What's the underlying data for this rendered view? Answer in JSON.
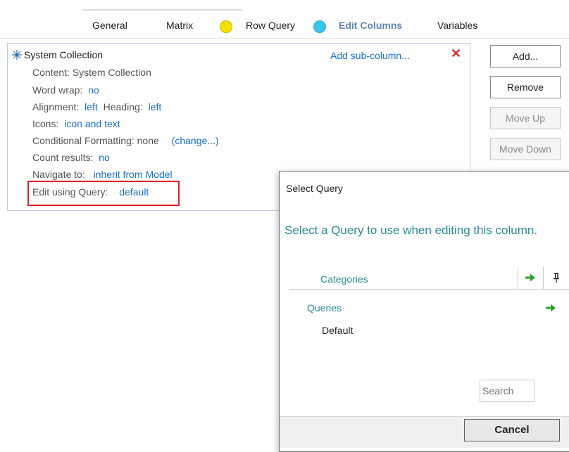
{
  "tabs": [
    {
      "label": "General"
    },
    {
      "label": "Matrix"
    },
    {
      "label": "Row Query"
    },
    {
      "label": "Edit Columns"
    },
    {
      "label": "Variables"
    }
  ],
  "column": {
    "title": "System Collection",
    "add_sub_column": "Add sub-column...",
    "delete_glyph": "✕",
    "content_label": "Content:",
    "content_value": "System Collection",
    "word_wrap_label": "Word wrap:",
    "word_wrap_value": "no",
    "alignment_label": "Alignment:",
    "alignment_value": "left",
    "heading_label": "Heading:",
    "heading_value": "left",
    "icons_label": "Icons:",
    "icons_value": "icon and text",
    "cond_format_label": "Conditional Formatting: none",
    "cond_format_change": "(change...)",
    "count_label": "Count results:",
    "count_value": "no",
    "navigate_label": "Navigate to:",
    "navigate_value": "inherit from Model",
    "edit_query_label": "Edit using Query:",
    "edit_query_value": "default"
  },
  "buttons": {
    "add": "Add...",
    "remove": "Remove",
    "move_up": "Move Up",
    "move_down": "Move Down"
  },
  "dialog": {
    "title": "Select Query",
    "description": "Select a Query to use when editing this column.",
    "categories_label": "Categories",
    "queries_label": "Queries",
    "items": [
      "Default"
    ],
    "search_placeholder": "Search",
    "cancel": "Cancel"
  },
  "colors": {
    "accent_teal": "#2b8a9b",
    "link_blue": "#1a6fd1",
    "highlight_red": "#e0202a",
    "row_query_dot": "#f2e100",
    "edit_columns_dot": "#3cc3ee",
    "arrow_green": "#2aa42a"
  }
}
